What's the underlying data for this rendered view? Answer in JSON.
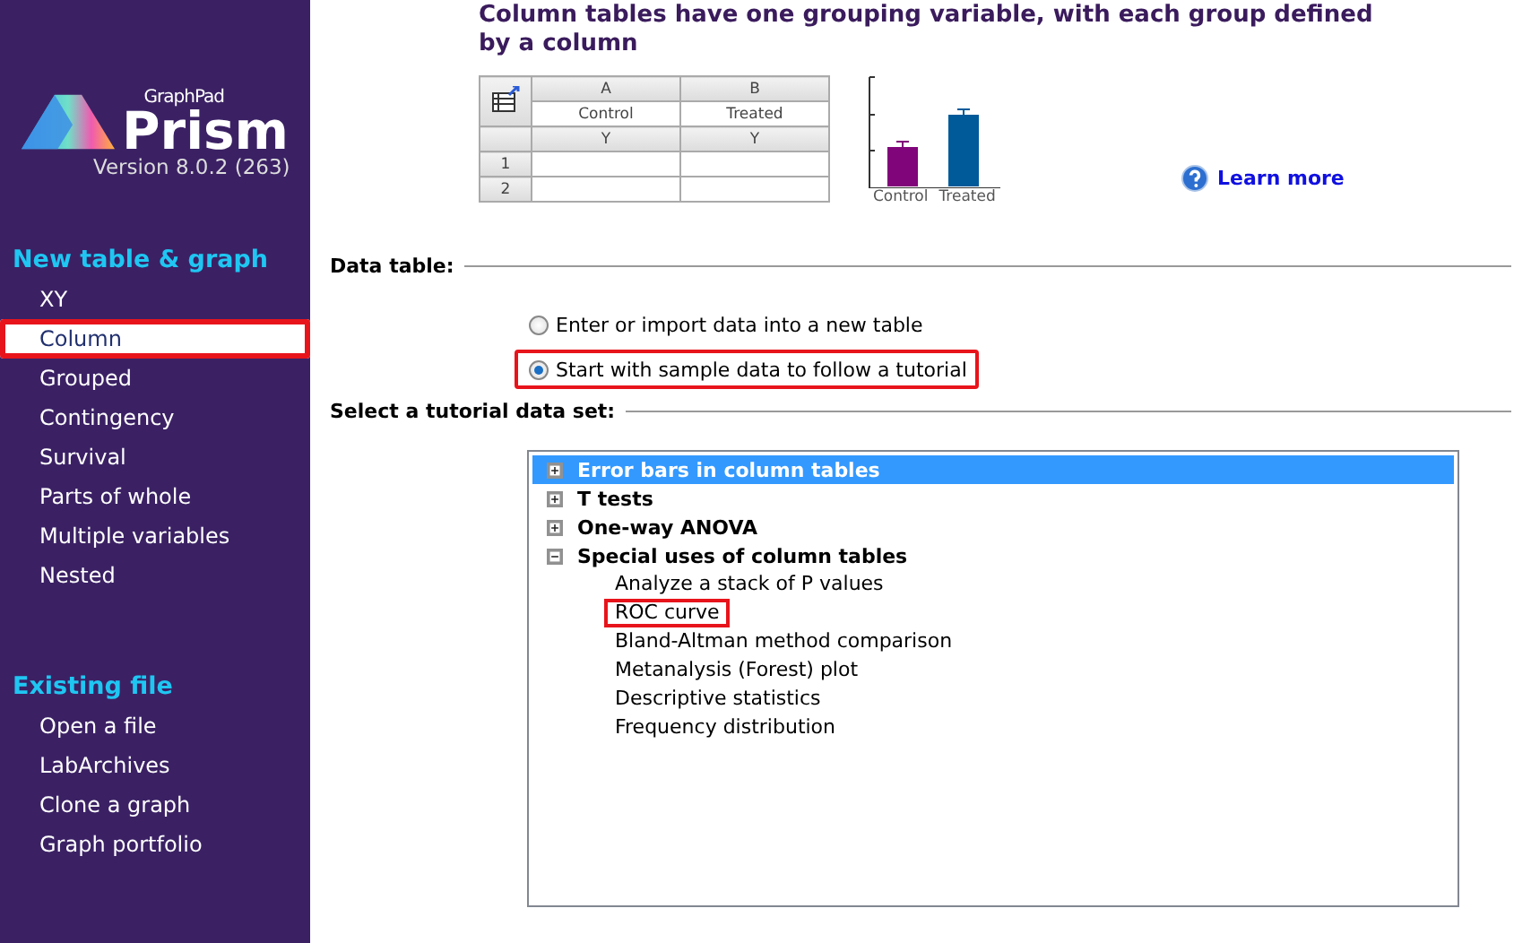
{
  "sidebar": {
    "logo": {
      "brand": "GraphPad",
      "product": "Prism",
      "version": "Version 8.0.2 (263)"
    },
    "sections": [
      {
        "title": "New table & graph",
        "items": [
          {
            "label": "XY",
            "selected": false,
            "highlighted": false
          },
          {
            "label": "Column",
            "selected": true,
            "highlighted": true
          },
          {
            "label": "Grouped",
            "selected": false,
            "highlighted": false
          },
          {
            "label": "Contingency",
            "selected": false,
            "highlighted": false
          },
          {
            "label": "Survival",
            "selected": false,
            "highlighted": false
          },
          {
            "label": "Parts of whole",
            "selected": false,
            "highlighted": false
          },
          {
            "label": "Multiple variables",
            "selected": false,
            "highlighted": false
          },
          {
            "label": "Nested",
            "selected": false,
            "highlighted": false
          }
        ]
      },
      {
        "title": "Existing file",
        "items": [
          {
            "label": "Open a file",
            "selected": false,
            "highlighted": false
          },
          {
            "label": "LabArchives",
            "selected": false,
            "highlighted": false
          },
          {
            "label": "Clone a graph",
            "selected": false,
            "highlighted": false
          },
          {
            "label": "Graph portfolio",
            "selected": false,
            "highlighted": false
          }
        ]
      }
    ]
  },
  "header": {
    "title": "Column tables have one grouping variable, with each group defined by a column",
    "sample_table": {
      "columns": [
        {
          "letter": "A",
          "name": "Control",
          "type": "Y"
        },
        {
          "letter": "B",
          "name": "Treated",
          "type": "Y"
        }
      ],
      "rows": [
        "1",
        "2"
      ]
    },
    "sample_chart": {
      "labels": [
        "Control",
        "Treated"
      ]
    },
    "learn_more": "Learn more"
  },
  "data_table": {
    "title": "Data table:",
    "options": [
      {
        "label": "Enter or import data into a new table",
        "selected": false,
        "highlighted": false
      },
      {
        "label": "Start with sample data to follow a tutorial",
        "selected": true,
        "highlighted": true
      }
    ]
  },
  "tutorial": {
    "title": "Select a tutorial data set:",
    "groups": [
      {
        "label": "Error bars in column tables",
        "expanded": false,
        "selected": true
      },
      {
        "label": "T tests",
        "expanded": false,
        "selected": false
      },
      {
        "label": "One-way ANOVA",
        "expanded": false,
        "selected": false
      },
      {
        "label": "Special uses of column tables",
        "expanded": true,
        "selected": false,
        "children": [
          {
            "label": "Analyze a stack of P values",
            "selected": false,
            "highlighted": false
          },
          {
            "label": "ROC curve",
            "selected": false,
            "highlighted": true
          },
          {
            "label": "Bland-Altman method comparison",
            "selected": false,
            "highlighted": false
          },
          {
            "label": "Metanalysis (Forest) plot",
            "selected": false,
            "highlighted": false
          },
          {
            "label": "Descriptive statistics",
            "selected": false,
            "highlighted": false
          },
          {
            "label": "Frequency distribution",
            "selected": false,
            "highlighted": false
          }
        ]
      }
    ]
  }
}
